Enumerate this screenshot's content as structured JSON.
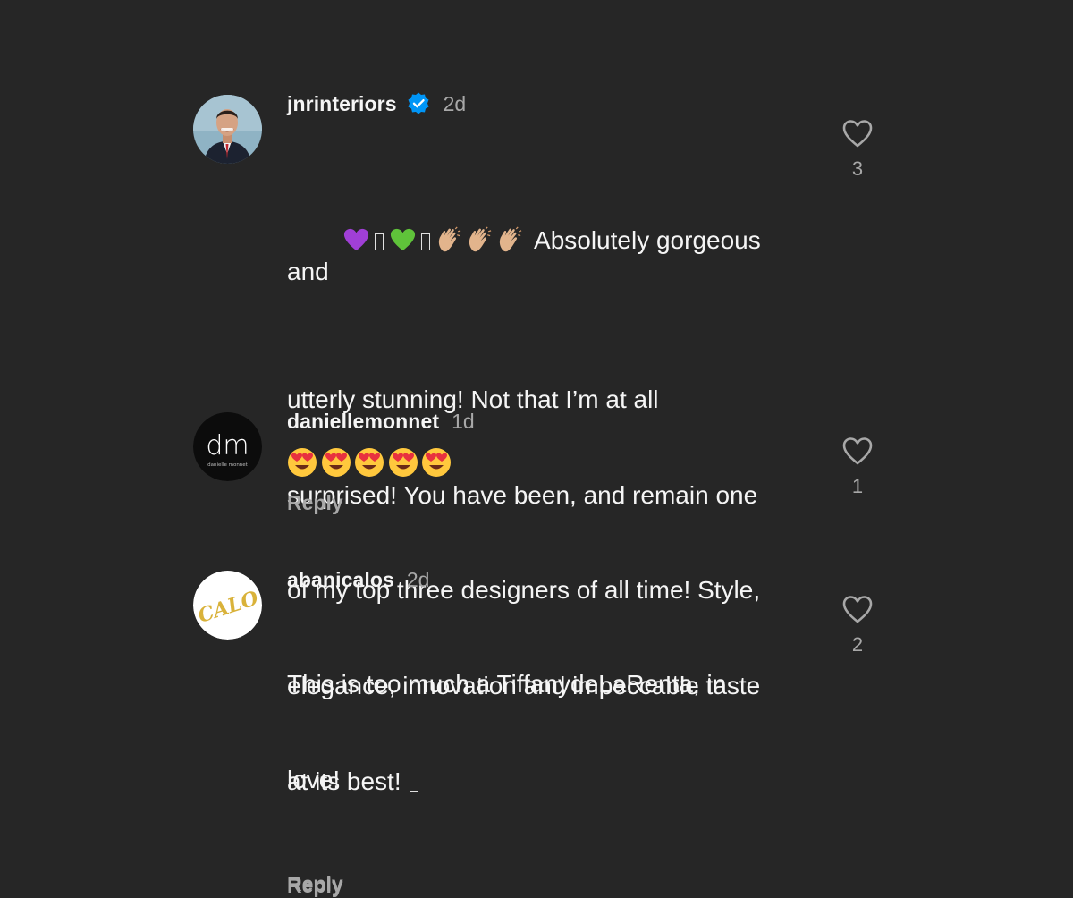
{
  "comments": [
    {
      "username": "jnrinteriors",
      "verified": true,
      "time": "2d",
      "text_line1_emoji": "💜▯💚▯👏🏼👏🏼👏🏼",
      "text": "Absolutely gorgeous and\nutterly stunning! Not that I’m at all\nsurprised! You have been, and remain one\nof my top three designers of all time! Style,\nelegance, innovation and impeccable taste\nat its best! ▯",
      "text_lines": [
        "Absolutely gorgeous and",
        "utterly stunning! Not that I’m at all",
        "surprised! You have been, and remain one",
        "of my top three designers of all time! Style,",
        "elegance, innovation and impeccable taste",
        "at its best!"
      ],
      "reply_label": "Reply",
      "likes": "3",
      "avatar_icon": "man-in-suit-portrait"
    },
    {
      "username": "daniellemonnet",
      "verified": false,
      "time": "1d",
      "emojis": [
        "😍",
        "😍",
        "😍",
        "😍",
        "😍"
      ],
      "reply_label": "Reply",
      "likes": "1",
      "avatar_icon": "dm-logo",
      "avatar_logo_text": "dm",
      "avatar_logo_sub": "danielle monnet"
    },
    {
      "username": "abanicalos",
      "verified": false,
      "time": "2d",
      "text_lines": [
        "This is too much a TiffanydeLaRenta, in",
        "love!"
      ],
      "reply_label": "Reply",
      "likes": "2",
      "avatar_icon": "calo-logo",
      "avatar_logo_text": "CALO"
    }
  ],
  "colors": {
    "background": "#262626",
    "text_primary": "#f5f5f5",
    "text_secondary": "#a8a8a8",
    "verified_blue": "#0095f6",
    "logo_gold": "#d9b23a"
  }
}
